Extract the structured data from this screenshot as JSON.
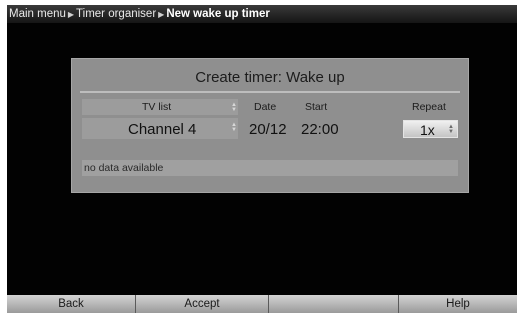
{
  "breadcrumb": {
    "items": [
      "Main menu",
      "Timer organiser",
      "New wake up timer"
    ]
  },
  "dialog": {
    "title": "Create timer: Wake up",
    "columns": {
      "tv_list": "TV list",
      "date": "Date",
      "start": "Start",
      "repeat": "Repeat"
    },
    "values": {
      "channel": "Channel 4",
      "date": "20/12",
      "start": "22:00",
      "repeat": "1x"
    },
    "info": "no data available"
  },
  "footer": {
    "buttons": [
      "Back",
      "Accept",
      "",
      "Help"
    ]
  },
  "icons": {
    "breadcrumb_separator": "right-triangle",
    "spinner": "up-down-arrows"
  }
}
